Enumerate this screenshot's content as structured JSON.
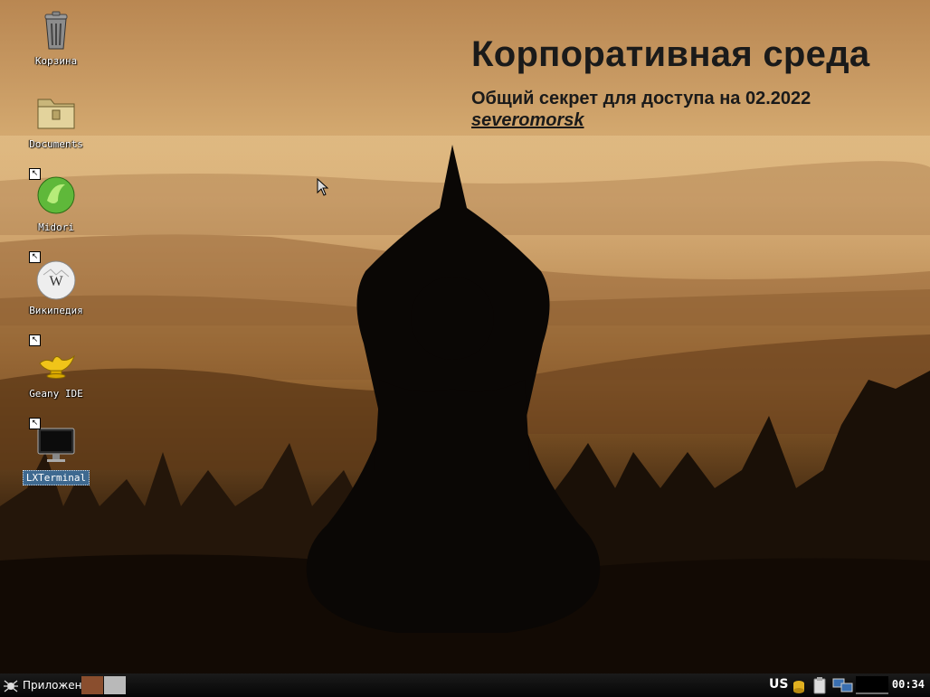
{
  "wallpaper": {
    "headline": "Корпоративная среда",
    "subline": "Общий секрет для доступа на 02.2022",
    "secret": "severomorsk"
  },
  "desktop_icons": [
    {
      "label": "Корзина",
      "icon": "trash-icon"
    },
    {
      "label": "Documents",
      "icon": "folder-icon"
    },
    {
      "label": "Midori",
      "icon": "midori-icon"
    },
    {
      "label": "Википедия",
      "icon": "wikipedia-icon"
    },
    {
      "label": "Geany IDE",
      "icon": "geany-lamp-icon"
    },
    {
      "label": "LXTerminal",
      "icon": "terminal-icon",
      "selected": true
    }
  ],
  "taskbar": {
    "menu_label": "Приложения",
    "keyboard_layout": "US",
    "clock": "00:34",
    "workspace_colors": [
      "#8a4e2e",
      "#b9b9b9"
    ]
  },
  "colors": {
    "taskbar_bg": "#0d0d0d",
    "selection": "#3e6990"
  }
}
